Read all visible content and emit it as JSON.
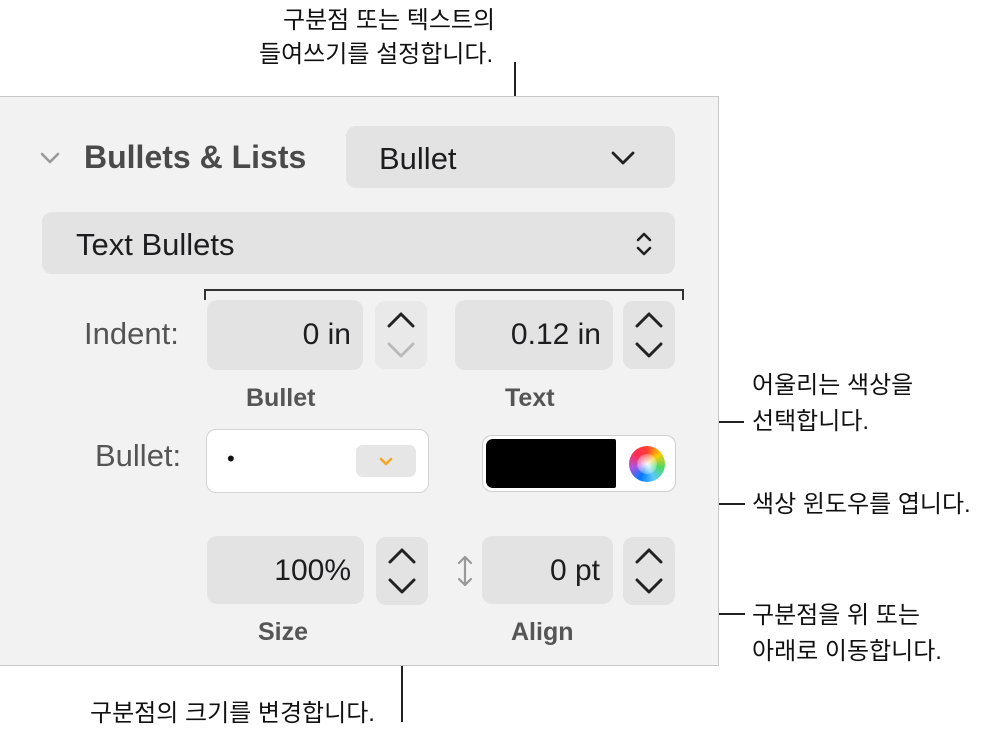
{
  "callouts": {
    "indent_line1": "구분점 또는 텍스트의",
    "indent_line2": "들여쓰기를 설정합니다.",
    "fill_line1": "어울리는 색상을",
    "fill_line2": "선택합니다.",
    "color_window": "색상 윈도우를 엽니다.",
    "move_line1": "구분점을 위 또는",
    "move_line2": "아래로 이동합니다.",
    "size": "구분점의 크기를 변경합니다."
  },
  "panel": {
    "section_title": "Bullets & Lists",
    "list_style": "Bullet",
    "bullet_type": "Text Bullets",
    "indent_label": "Indent:",
    "bullet_indent_value": "0 in",
    "text_indent_value": "0.12 in",
    "bullet_caption": "Bullet",
    "text_caption": "Text",
    "bullet_label": "Bullet:",
    "bullet_char": "•",
    "bullet_color": "#000000",
    "size_value": "100%",
    "size_caption": "Size",
    "align_value": "0 pt",
    "align_caption": "Align"
  },
  "icons": {
    "disclosure": "chevron-down-icon",
    "popup": "chevron-down-icon",
    "popup_updown": "chevron-up-down-icon",
    "stepper": "stepper-icon",
    "color_wheel": "color-wheel-icon",
    "align_arrows": "vertical-arrows-icon"
  },
  "colors": {
    "accent_orange": "#f5a623",
    "panel_bg": "#f2f2f2",
    "control_bg": "#e3e3e3"
  }
}
